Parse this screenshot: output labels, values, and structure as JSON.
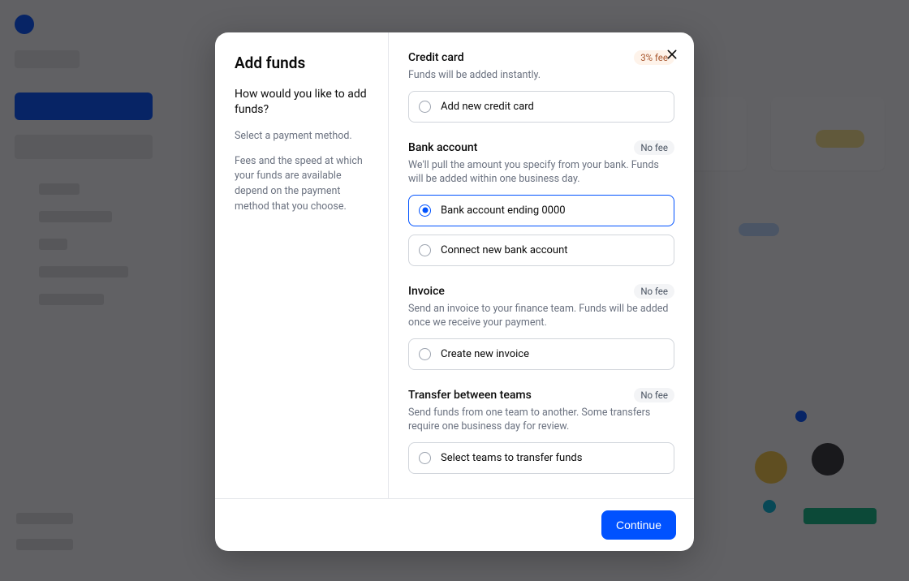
{
  "modal": {
    "title": "Add funds",
    "subtitle": "How would you like to add funds?",
    "instruction": "Select a payment method.",
    "disclaimer": "Fees and the speed at which your funds are available depend on the payment method that you choose.",
    "continue_label": "Continue"
  },
  "sections": {
    "credit_card": {
      "title": "Credit card",
      "fee": "3% fee",
      "desc": "Funds will be added instantly.",
      "options": [
        {
          "label": "Add new credit card"
        }
      ]
    },
    "bank": {
      "title": "Bank account",
      "fee": "No fee",
      "desc": "We'll pull the amount you specify from your bank. Funds will be added within one business day.",
      "options": [
        {
          "label": "Bank account ending 0000"
        },
        {
          "label": "Connect new bank account"
        }
      ]
    },
    "invoice": {
      "title": "Invoice",
      "fee": "No fee",
      "desc": "Send an invoice to your finance team. Funds will be added once we receive your payment.",
      "options": [
        {
          "label": "Create new invoice"
        }
      ]
    },
    "transfer": {
      "title": "Transfer between teams",
      "fee": "No fee",
      "desc": "Send funds from one team to another. Some transfers require one business day for review.",
      "options": [
        {
          "label": "Select teams to transfer funds"
        }
      ]
    }
  }
}
